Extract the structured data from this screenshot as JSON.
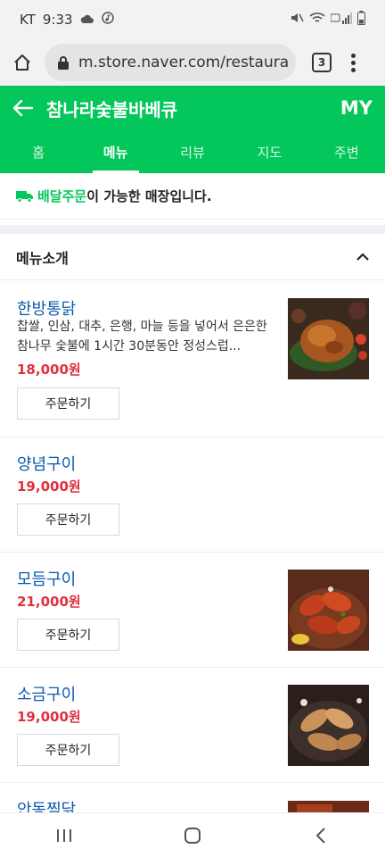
{
  "status_bar": {
    "carrier": "KT",
    "time": "9:33"
  },
  "browser": {
    "url": "m.store.naver.com/restaura",
    "tab_count": "3"
  },
  "header": {
    "title": "참나라숯불바베큐",
    "my_label": "MY"
  },
  "tabs": [
    {
      "label": "홈"
    },
    {
      "label": "메뉴"
    },
    {
      "label": "리뷰"
    },
    {
      "label": "지도"
    },
    {
      "label": "주변"
    }
  ],
  "active_tab": "메뉴",
  "notice": {
    "highlight": "배달주문",
    "rest": "이 가능한 매장입니다."
  },
  "section": {
    "title": "메뉴소개"
  },
  "order_label": "주문하기",
  "menu_items": [
    {
      "name": "한방통닭",
      "desc": "찹쌀, 인삼, 대추, 은행, 마늘 등을 넣어서 은은한 참나무 숯불에 1시간 30분동안 정성스럽...",
      "price": "18,000원"
    },
    {
      "name": "양념구이",
      "price": "19,000원"
    },
    {
      "name": "모듬구이",
      "price": "21,000원"
    },
    {
      "name": "소금구이",
      "price": "19,000원"
    },
    {
      "name": "안동찜닭"
    }
  ],
  "colors": {
    "brand_green": "#03c75a",
    "price_red": "#e0303e",
    "link_blue": "#0b5cad"
  }
}
